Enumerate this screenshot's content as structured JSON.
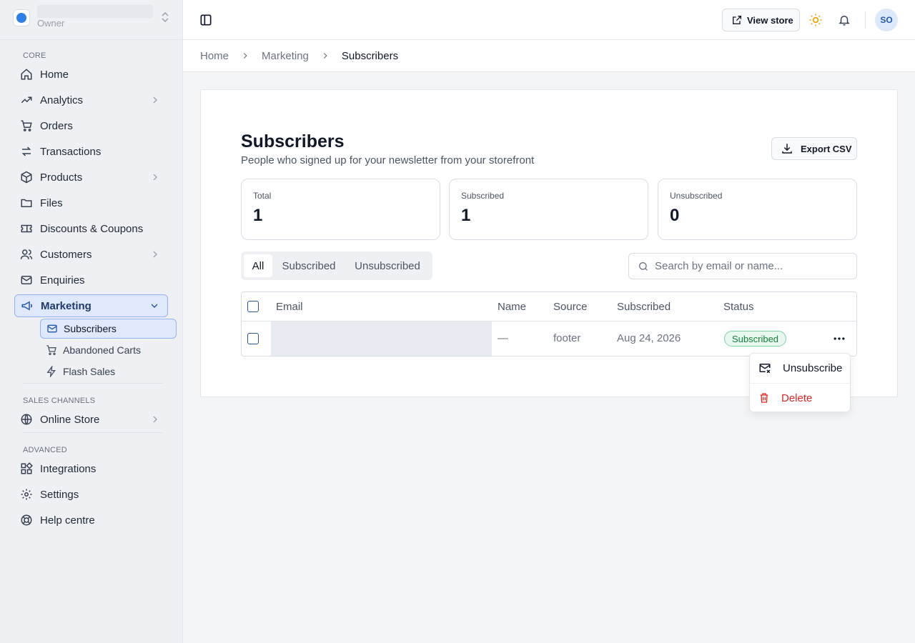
{
  "store": {
    "role": "Owner"
  },
  "sidebar": {
    "core_label": "CORE",
    "items": [
      {
        "label": "Home",
        "icon": "home-icon"
      },
      {
        "label": "Analytics",
        "icon": "trending-up-icon"
      },
      {
        "label": "Orders",
        "icon": "cart-icon"
      },
      {
        "label": "Transactions",
        "icon": "transfer-icon"
      },
      {
        "label": "Products",
        "icon": "box-icon"
      },
      {
        "label": "Files",
        "icon": "folder-icon"
      },
      {
        "label": "Discounts & Coupons",
        "icon": "ticket-icon"
      },
      {
        "label": "Customers",
        "icon": "users-icon"
      },
      {
        "label": "Enquiries",
        "icon": "mail-icon"
      },
      {
        "label": "Marketing",
        "icon": "megaphone-icon"
      }
    ],
    "marketing_sub": [
      {
        "label": "Subscribers",
        "icon": "mail-icon"
      },
      {
        "label": "Abandoned Carts",
        "icon": "cart-icon"
      },
      {
        "label": "Flash Sales",
        "icon": "bolt-icon"
      }
    ],
    "sales_label": "SALES CHANNELS",
    "online_store": "Online Store",
    "advanced_label": "ADVANCED",
    "advanced_items": [
      {
        "label": "Integrations",
        "icon": "blocks-icon"
      },
      {
        "label": "Settings",
        "icon": "gear-icon"
      },
      {
        "label": "Help centre",
        "icon": "lifebuoy-icon"
      }
    ]
  },
  "topbar": {
    "view_store": "View store",
    "avatar_initials": "SO"
  },
  "breadcrumb": [
    "Home",
    "Marketing",
    "Subscribers"
  ],
  "page": {
    "title": "Subscribers",
    "subtitle": "People who signed up for your newsletter from your storefront",
    "export_label": "Export CSV"
  },
  "stats": [
    {
      "label": "Total",
      "value": "1"
    },
    {
      "label": "Subscribed",
      "value": "1"
    },
    {
      "label": "Unsubscribed",
      "value": "0"
    }
  ],
  "filters": {
    "tabs": [
      "All",
      "Subscribed",
      "Unsubscribed"
    ],
    "active": "All"
  },
  "search": {
    "placeholder": "Search by email or name...",
    "value": ""
  },
  "table": {
    "columns": [
      "Email",
      "Name",
      "Source",
      "Subscribed",
      "Status"
    ],
    "rows": [
      {
        "name": "—",
        "source": "footer",
        "subscribed": "Aug 24, 2026",
        "status": "Subscribed"
      }
    ]
  },
  "menu": {
    "unsubscribe": "Unsubscribe",
    "delete": "Delete"
  },
  "colors": {
    "accent": "#2657a6",
    "active_bg": "#dfe9fb",
    "status_green": "#15803d",
    "danger": "#dc2626",
    "sun": "#f0a000"
  }
}
